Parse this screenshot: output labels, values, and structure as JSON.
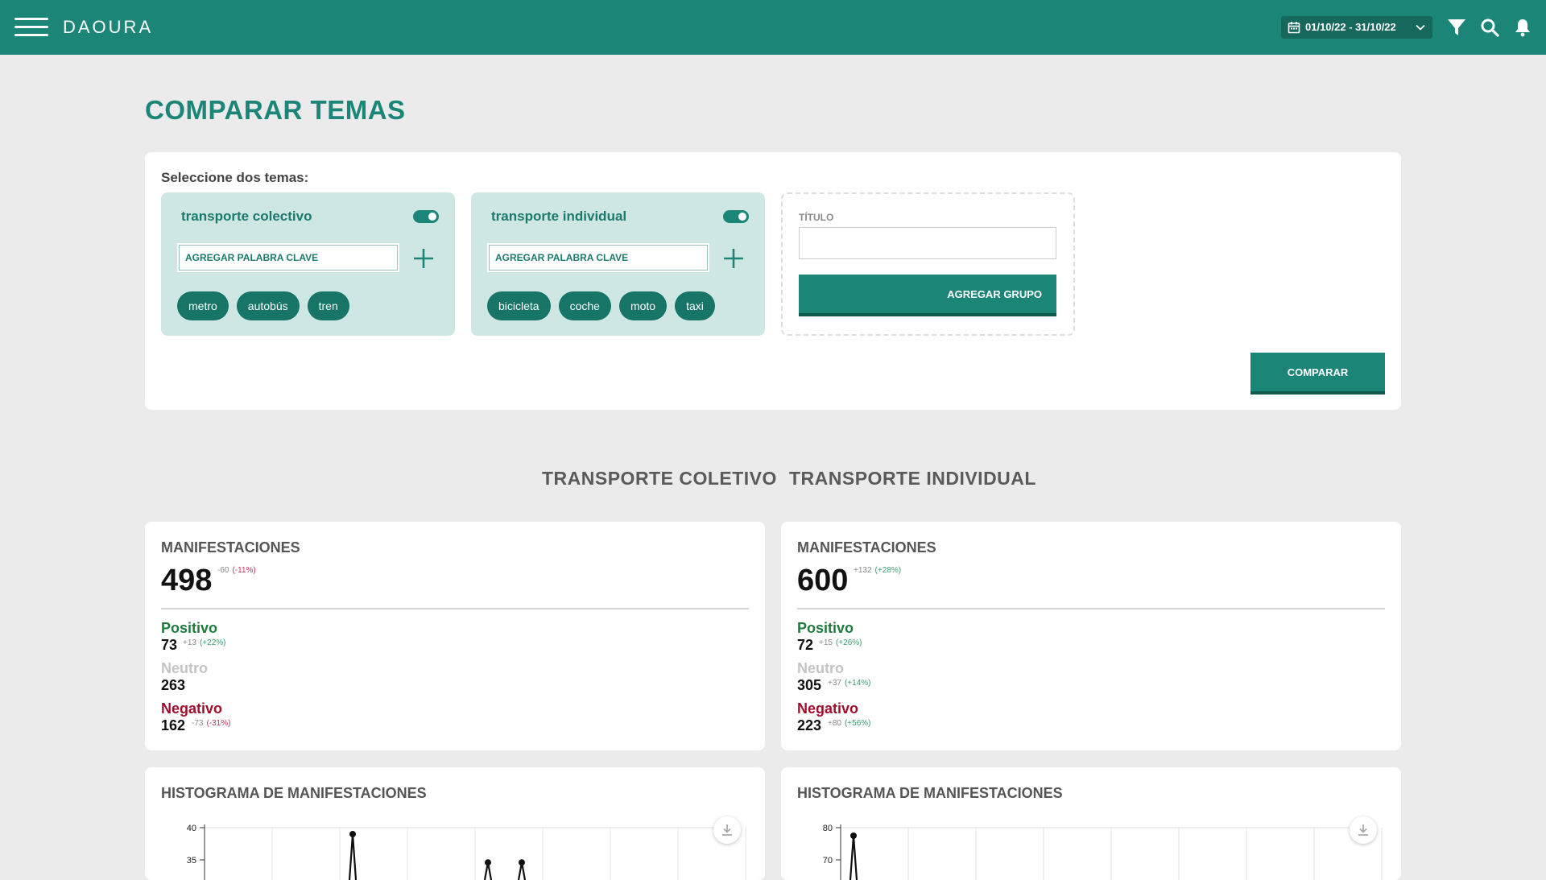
{
  "header": {
    "logo": "DAOURA",
    "date_range": "01/10/22 - 31/10/22",
    "icons": [
      "menu-icon",
      "calendar-icon",
      "chevron-down-icon",
      "filter-icon",
      "search-icon",
      "bell-icon"
    ]
  },
  "page": {
    "title": "COMPARAR TEMAS"
  },
  "compare": {
    "select_label": "Seleccione dos temas:",
    "keyword_placeholder": "AGREGAR PALABRA CLAVE",
    "topics": [
      {
        "name": "transporte colectivo",
        "enabled": true,
        "keywords": [
          "metro",
          "autobús",
          "tren"
        ]
      },
      {
        "name": "transporte individual",
        "enabled": true,
        "keywords": [
          "bicicleta",
          "coche",
          "moto",
          "taxi"
        ]
      }
    ],
    "new_group": {
      "title_label": "TÍTULO",
      "title_value": "",
      "button_label": "AGREGAR GRUPO"
    },
    "compare_button": "COMPARAR"
  },
  "results": {
    "headings": [
      "TRANSPORTE COLETIVO",
      "TRANSPORTE INDIVIDUAL"
    ],
    "panels": [
      {
        "title": "MANIFESTACIONES",
        "total": "498",
        "total_delta": "-60",
        "total_pct": "(-11%)",
        "positive": {
          "label": "Positivo",
          "value": "73",
          "delta": "+13",
          "pct": "(+22%)"
        },
        "neutral": {
          "label": "Neutro",
          "value": "263",
          "delta": "",
          "pct": ""
        },
        "negative": {
          "label": "Negativo",
          "value": "162",
          "delta": "-73",
          "pct": "(-31%)"
        }
      },
      {
        "title": "MANIFESTACIONES",
        "total": "600",
        "total_delta": "+132",
        "total_pct": "(+28%)",
        "positive": {
          "label": "Positivo",
          "value": "72",
          "delta": "+15",
          "pct": "(+26%)"
        },
        "neutral": {
          "label": "Neutro",
          "value": "305",
          "delta": "+37",
          "pct": "(+14%)"
        },
        "negative": {
          "label": "Negativo",
          "value": "223",
          "delta": "+80",
          "pct": "(+56%)"
        }
      }
    ],
    "histograms": [
      {
        "title": "HISTOGRAMA DE MANIFESTACIONES",
        "y_ticks": [
          "40",
          "35"
        ]
      },
      {
        "title": "HISTOGRAMA DE MANIFESTACIONES",
        "y_ticks": [
          "80",
          "70"
        ]
      }
    ]
  },
  "chart_data": [
    {
      "type": "line",
      "title": "HISTOGRAMA DE MANIFESTACIONES",
      "ylim_visible": [
        35,
        40
      ],
      "y_ticks": [
        40,
        35
      ],
      "visible_points": [
        {
          "x_index": 2,
          "y": 39
        },
        {
          "x_index": 4,
          "y": 34.6
        },
        {
          "x_index": 4.5,
          "y": 34.6
        }
      ],
      "grid": true
    },
    {
      "type": "line",
      "title": "HISTOGRAMA DE MANIFESTACIONES",
      "ylim_visible": [
        70,
        80
      ],
      "y_ticks": [
        80,
        70
      ],
      "visible_points": [
        {
          "x_index": 0,
          "y": 77.5
        }
      ],
      "grid": true
    }
  ]
}
